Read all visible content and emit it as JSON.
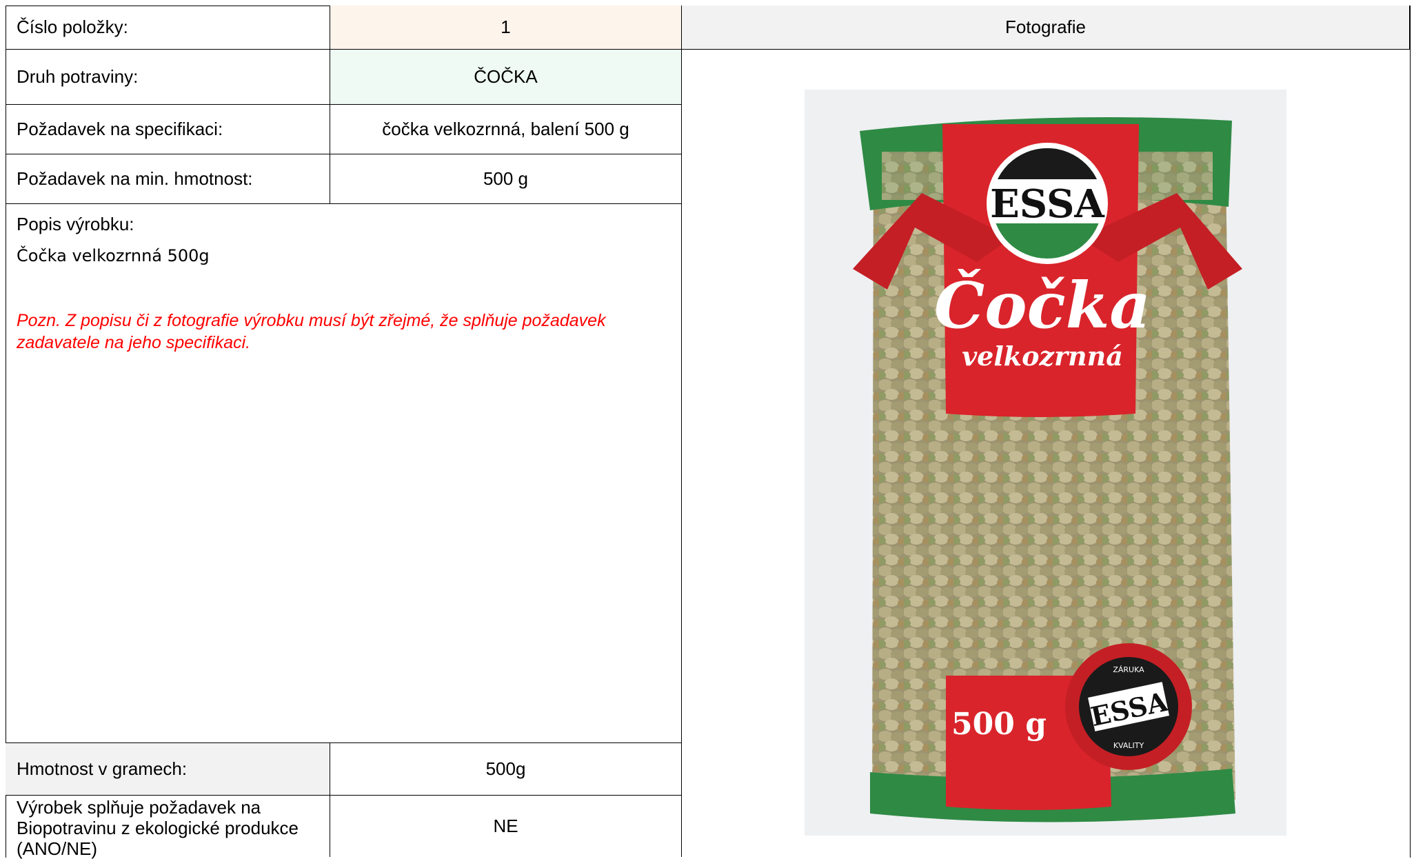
{
  "table": {
    "item_number_label": "Číslo položky:",
    "item_number_value": "1",
    "photo_header": "Fotografie",
    "food_type_label": "Druh potraviny:",
    "food_type_value": "ČOČKA",
    "spec_label": "Požadavek na specifikaci:",
    "spec_value": "čočka velkozrnná, balení 500 g",
    "min_weight_label": "Požadavek na min. hmotnost:",
    "min_weight_value": "500 g",
    "description_label": "Popis výrobku:",
    "description_value": "Čočka velkozrnná 500g",
    "description_note": "Pozn. Z popisu či z fotografie výrobku musí být zřejmé, že splňuje požadavek zadavatele na jeho specifikaci.",
    "weight_label": "Hmotnost v gramech:",
    "weight_value": "500g",
    "bio_label": "Výrobek splňuje požadavek na Biopotravinu z ekologické produkce (ANO/NE)",
    "bio_value": "NE"
  },
  "photo": {
    "brand": "ESSA",
    "product_name": "Čočka",
    "product_subtitle": "velkozrnná",
    "weight": "500 g",
    "seal_text_top": "ZÁRUKA",
    "seal_text_bottom": "KVALITY",
    "colors": {
      "red": "#d9242b",
      "green": "#2f8a44",
      "lentil": "#a89f73"
    }
  }
}
